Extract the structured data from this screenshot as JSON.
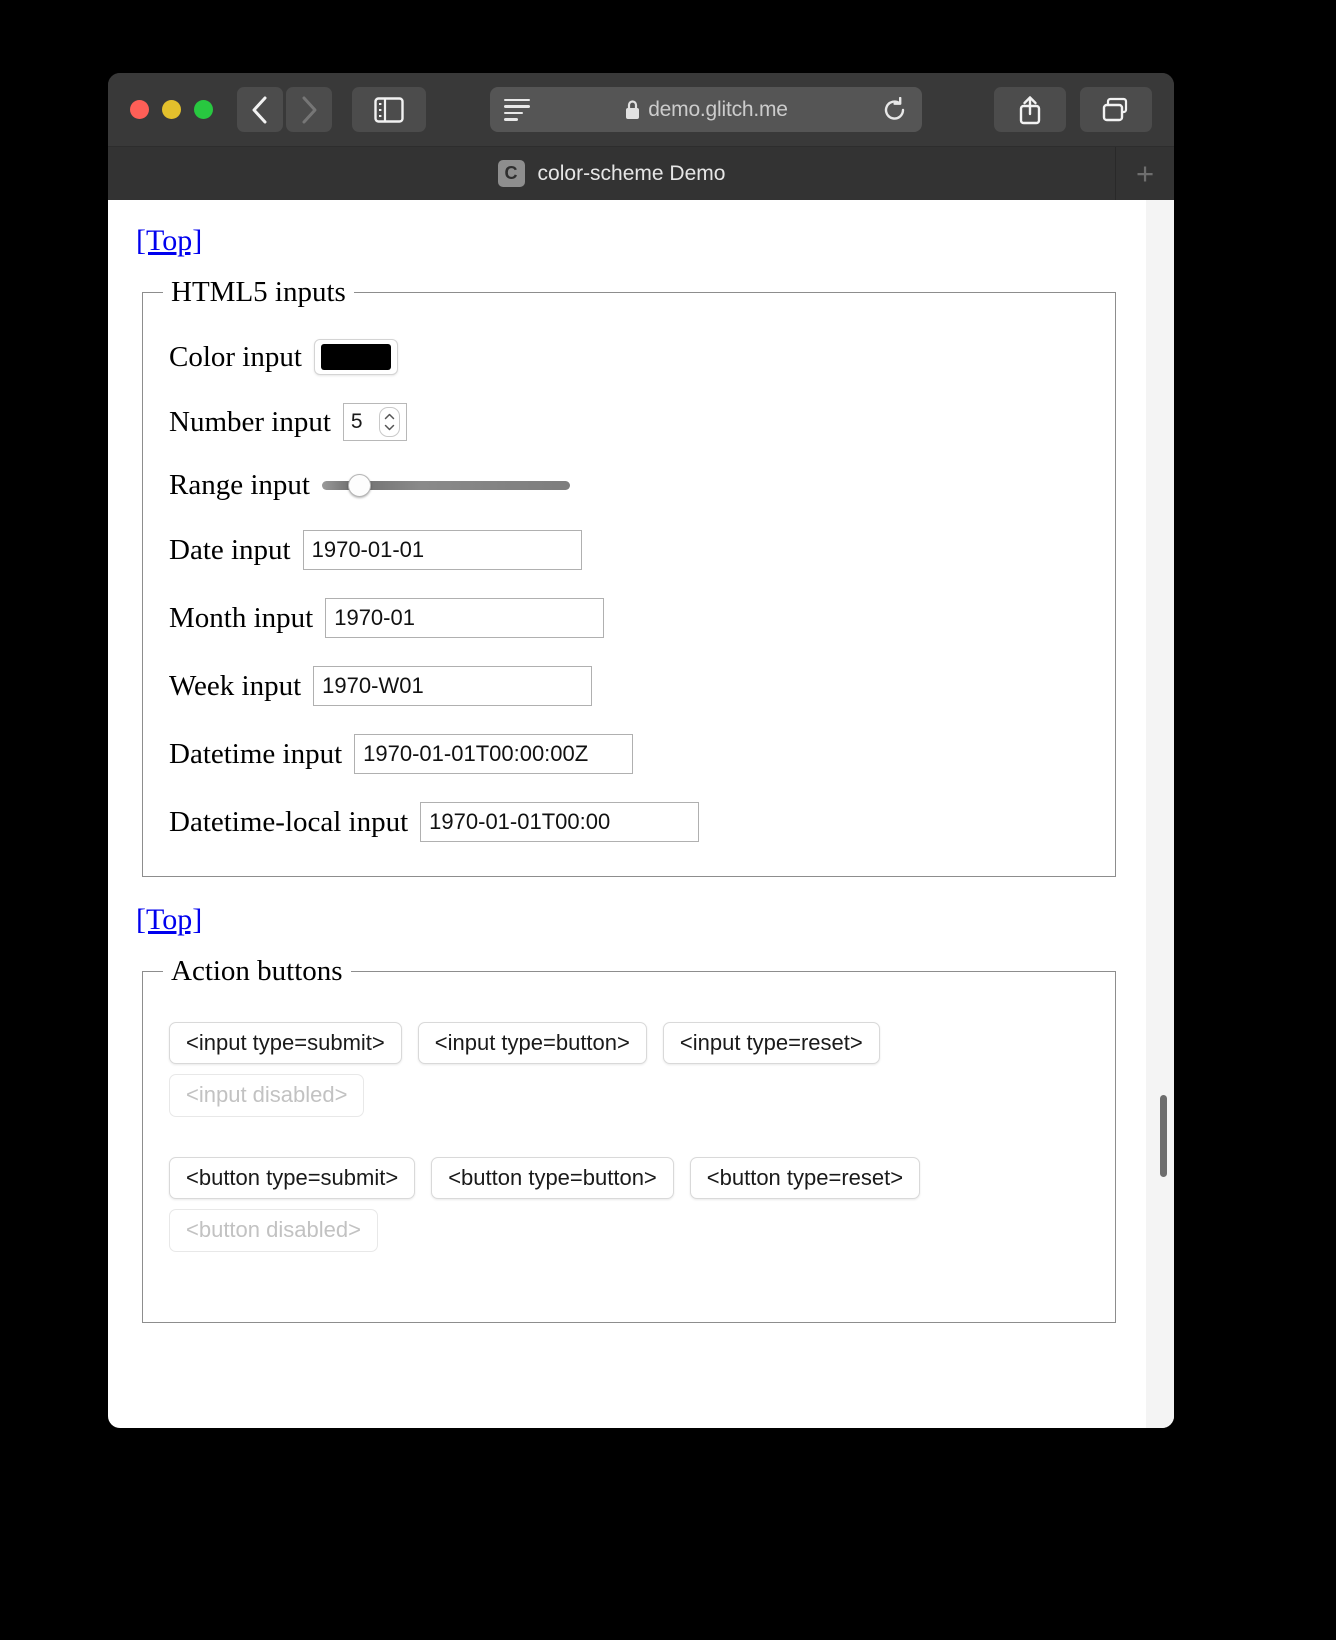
{
  "browser": {
    "window_controls": [
      {
        "name": "close",
        "color": "#ff5f57"
      },
      {
        "name": "minimize",
        "color": "#e3c02c"
      },
      {
        "name": "zoom",
        "color": "#28c840"
      }
    ],
    "back_label": "‹",
    "forward_label": "›",
    "url": {
      "prefix": "",
      "host": "demo.glitch.me",
      "secure": true
    },
    "newtab_label": "+",
    "tab": {
      "favicon_letter": "C",
      "title": "color-scheme Demo"
    }
  },
  "page": {
    "top_link_1": "[Top]",
    "top_link_2": "[Top]",
    "html5_inputs": {
      "legend": "HTML5 inputs",
      "rows": [
        {
          "label": "Color input",
          "kind": "color",
          "value": "#000000"
        },
        {
          "label": "Number input",
          "kind": "number",
          "value": "5"
        },
        {
          "label": "Range input",
          "kind": "range",
          "value": "15"
        },
        {
          "label": "Date input",
          "kind": "text",
          "value": "1970-01-01"
        },
        {
          "label": "Month input",
          "kind": "text",
          "value": "1970-01"
        },
        {
          "label": "Week input",
          "kind": "text",
          "value": "1970-W01"
        },
        {
          "label": "Datetime input",
          "kind": "text",
          "value": "1970-01-01T00:00:00Z"
        },
        {
          "label": "Datetime-local input",
          "kind": "text",
          "value": "1970-01-01T00:00"
        }
      ]
    },
    "action_buttons": {
      "legend": "Action buttons",
      "input_row": [
        {
          "label": "<input type=submit>",
          "disabled": false
        },
        {
          "label": "<input type=button>",
          "disabled": false
        },
        {
          "label": "<input type=reset>",
          "disabled": false
        }
      ],
      "input_disabled_row": [
        {
          "label": "<input disabled>",
          "disabled": true
        }
      ],
      "button_row": [
        {
          "label": "<button type=submit>",
          "disabled": false
        },
        {
          "label": "<button type=button>",
          "disabled": false
        },
        {
          "label": "<button type=reset>",
          "disabled": false
        }
      ],
      "button_disabled_row": [
        {
          "label": "<button disabled>",
          "disabled": true
        }
      ]
    }
  },
  "colors": {
    "link": "#0000ee",
    "color_swatch": "#000000",
    "toolbar_bg": "#393939",
    "tabbar_bg": "#333333"
  }
}
